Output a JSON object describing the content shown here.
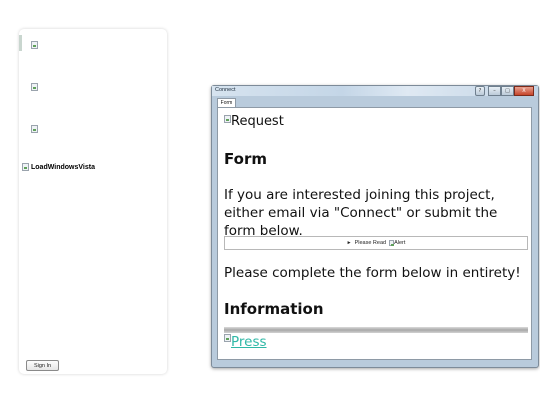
{
  "sidebar": {
    "images": [
      {
        "alt": ""
      },
      {
        "alt": ""
      },
      {
        "alt": ""
      }
    ],
    "logo_alt": "LoadWindowsVista",
    "signin_label": "Sign In"
  },
  "window": {
    "title": "Connect",
    "buttons": {
      "help": "?",
      "minimize": "–",
      "maximize": "□",
      "close": "X"
    },
    "tab_label": "Form",
    "content": {
      "request_img_alt": "Request",
      "heading_form": "Form",
      "intro_text": "If you are interested joining this project, either email via \"Connect\" or submit the form below.",
      "readbar": {
        "arrow": "►",
        "label": "Please Read",
        "alert_alt": "Alert"
      },
      "complete_text": "Please complete the form below in entirety!",
      "heading_information": "Information",
      "progress_fraction": 1.0,
      "press_link": "Press"
    }
  },
  "colors": {
    "link": "#2fb8a6",
    "close_button": "#c6442a"
  }
}
